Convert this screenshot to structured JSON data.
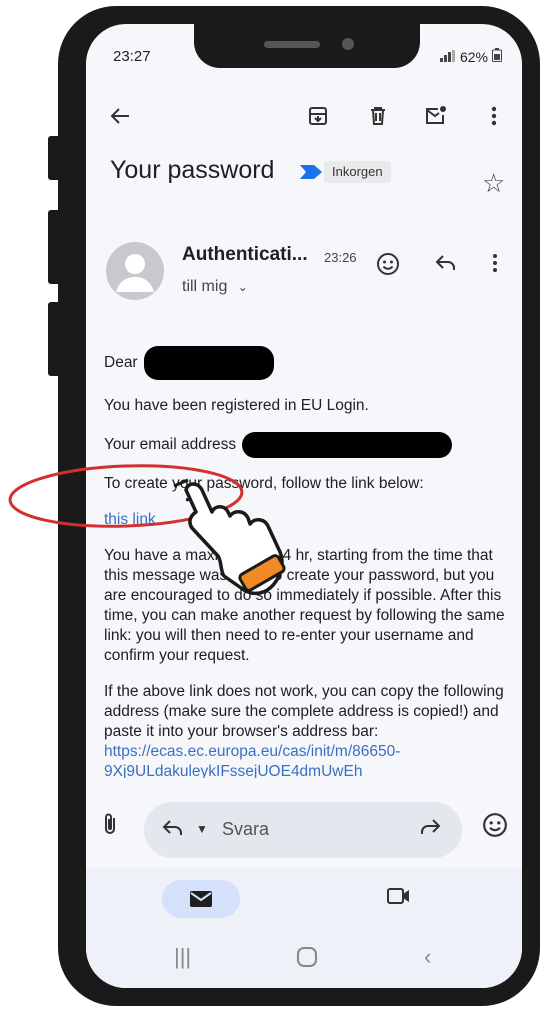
{
  "status": {
    "time": "23:27",
    "battery": "62%"
  },
  "toolbar": {
    "back_icon": "back-arrow-icon",
    "archive_icon": "archive-icon",
    "delete_icon": "trash-icon",
    "unread_icon": "mark-unread-icon",
    "more_icon": "more-vertical-icon"
  },
  "email": {
    "subject": "Your password",
    "label": "Inkorgen",
    "sender": "Authenticati...",
    "time": "23:26",
    "to": "till mig",
    "body": {
      "greeting": "Dear",
      "line1": "You have been registered in EU Login.",
      "email_label": "Your email address",
      "create_intro": "To create your password, follow the link below:",
      "link_text": "this link",
      "para_validity": "You have a maximum of 24 hr, starting from the time that this message was sent, to create your password, but you are encouraged to do so immediately if possible. After this time, you can make another request by following the same link: you will then need to re-enter your username and confirm your request.",
      "para_copy": "If the above link does not work, you can copy the following address (make sure the complete address is copied!) and paste it into your browser's address bar:",
      "url_line1": "https://ecas.ec.europa.eu/cas/init/m/86650-",
      "url_line2": "9Xj9ULdakuleykIFssejUOE4dmUwEh"
    }
  },
  "reply": {
    "placeholder": "Svara"
  },
  "colors": {
    "link": "#3b6fc2",
    "highlight_circle": "#d32f2f",
    "nav_active": "#d5e1fa"
  }
}
